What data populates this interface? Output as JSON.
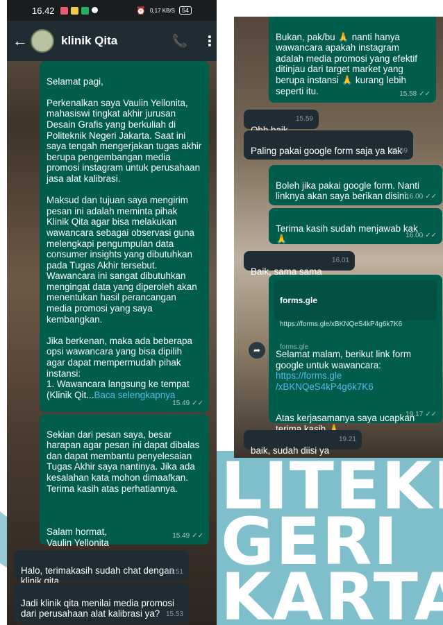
{
  "left": {
    "status_bar": {
      "time": "16.42",
      "right_text": "0,17 KB/S",
      "battery": "54"
    },
    "header": {
      "contact_name": "klinik Qita"
    },
    "messages": [
      {
        "side": "out",
        "text": "Selamat pagi,\n\nPerkenalkan saya Vaulin Yellonita, mahasiswi tingkat akhir jurusan Desain Grafis yang berkuliah di Politeknik Negeri Jakarta. Saat ini saya tengah mengerjakan tugas akhir berupa pengembangan media promosi instagram untuk perusahaan jasa alat kalibrasi.\n\nMaksud dan tujuan saya mengirim pesan ini adalah meminta pihak Klinik Qita agar bisa melakukan wawancara sebagai observasi guna melengkapi pengumpulan data consumer insights yang dibutuhkan pada Tugas Akhir tersebut. Wawancara ini sangat dibutuhkan mengingat data yang diperoleh akan menentukan hasil perancangan media promosi yang saya kembangkan.\n\nJika berkenan, maka ada beberapa opsi wawancara yang bisa dipilih agar dapat mempermudah pihak instansi:\n1. Wawancara langsung ke tempat (Klinik Qit...",
        "read_more": "Baca selengkapnya",
        "time": "15.49"
      },
      {
        "side": "out",
        "text": "Sekian dari pesan saya, besar harapan agar pesan ini dapat dibalas dan dapat membantu penyelesaian Tugas Akhir saya nantinya. Jika ada kesalahan kata mohon dimaafkan. Terima kasih atas perhatiannya.\n\n\n\nSalam hormat,\nVaulin Yellonita",
        "time": "15.49"
      },
      {
        "side": "in",
        "text": "Halo, terimakasih sudah chat dengan klinik qita",
        "time": "15.51"
      },
      {
        "side": "in",
        "text": "Jadi klinik qita menilai media promosi dari perusahaan alat kalibrasi ya?",
        "time": "15.53"
      }
    ]
  },
  "right": {
    "messages": [
      {
        "side": "out",
        "text": "Bukan, pak/bu 🙏 nanti hanya wawancara apakah instagram adalah media promosi yang efektif ditinjau dari target market yang berupa instansi 🙏 kurang lebih seperti itu.",
        "time": "15.58"
      },
      {
        "side": "in",
        "text": "Ohh baik",
        "time": "15.59"
      },
      {
        "side": "in",
        "text": "Paling pakai google form saja ya kak",
        "time": "15.59"
      },
      {
        "side": "out",
        "text": "Boleh jika pakai google form. Nanti linknya akan saya berikan disini.",
        "time": "16.00"
      },
      {
        "side": "out",
        "text": "Terima kasih sudah menjawab kak\n🙏",
        "time": "16.00"
      },
      {
        "side": "in",
        "text": "Baik, sama sama",
        "time": "16.01"
      },
      {
        "side": "out",
        "preview_title": "forms.gle",
        "preview_url": "https://forms.gle/xBKNQeS4kP4g6k7K6",
        "preview_domain": "forms.gle",
        "text": "Selamat malam, berikut link form google untuk wawancara:",
        "link": "https://forms.gle\n/xBKNQeS4kP4g6k7K6",
        "text2": "Atas kerjasamanya saya ucapkan terima kasih 🙏",
        "time": "19.17"
      },
      {
        "side": "in",
        "text": "baik, sudah diisi ya",
        "time": "19.21"
      }
    ]
  },
  "watermark": {
    "line1": "LITEKNI",
    "line2": "GERI",
    "line3": "KARTA"
  }
}
